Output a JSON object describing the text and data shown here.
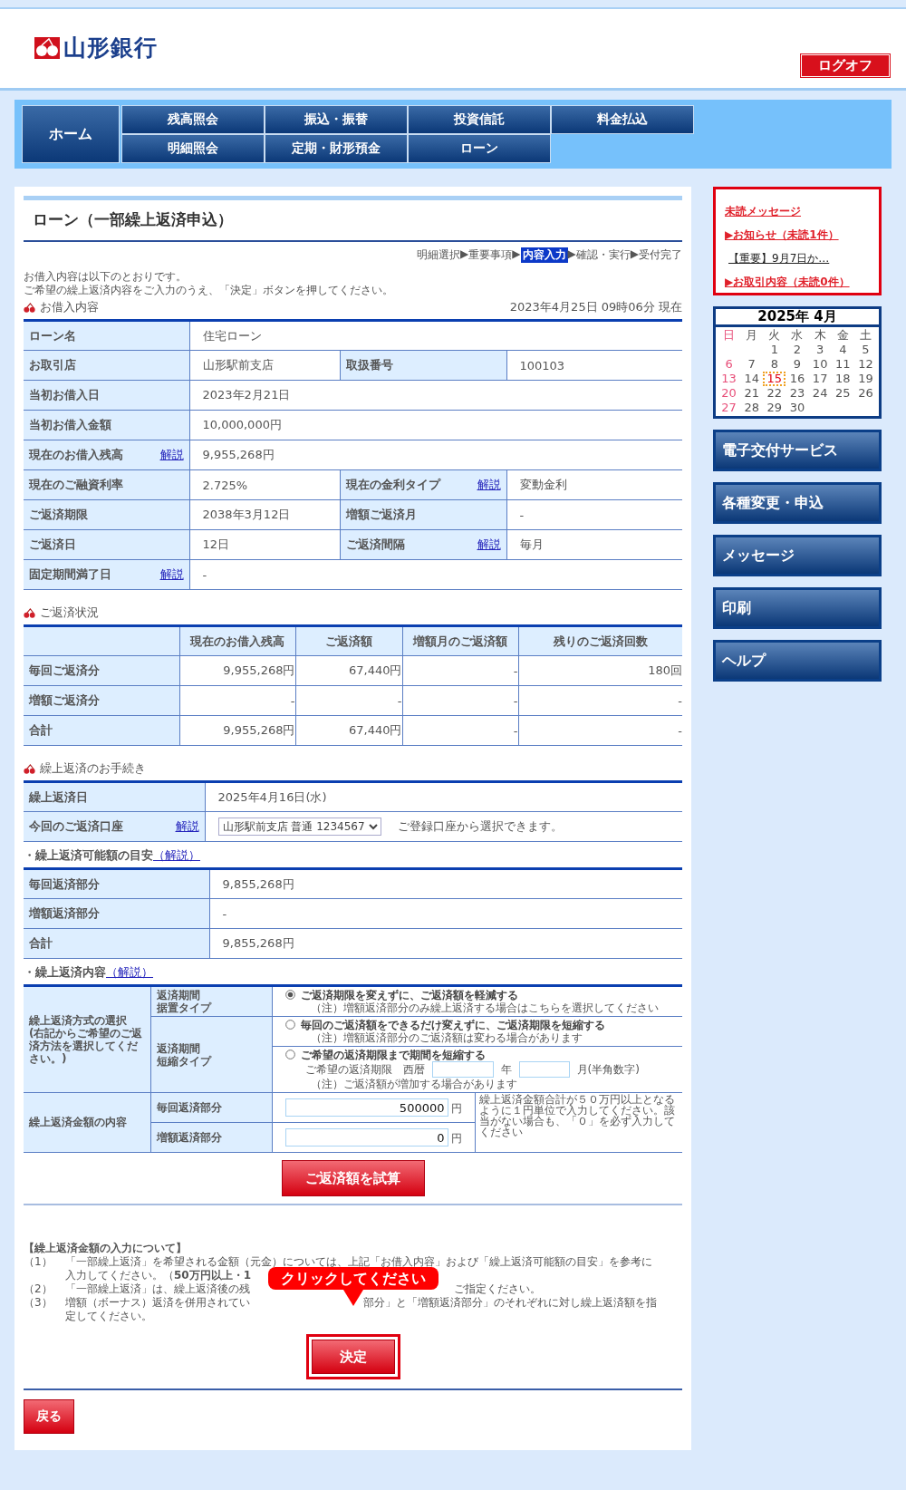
{
  "header": {
    "logo": "山形銀行",
    "logoff": "ログオフ"
  },
  "nav": {
    "home": "ホーム",
    "rows": [
      [
        "残高照会",
        "振込・振替",
        "投資信託",
        "料金払込"
      ],
      [
        "明細照会",
        "定期・財形預金",
        "ローン"
      ]
    ]
  },
  "page_title": "ローン（一部繰上返済申込）",
  "steps": [
    {
      "label": "明細選択",
      "selected": false,
      "after": "▶"
    },
    {
      "label": "重要事項",
      "selected": false,
      "after": "▶"
    },
    {
      "label": "内容入力",
      "selected": true,
      "after": "▶"
    },
    {
      "label": "確認・実行",
      "selected": false,
      "after": "▶"
    },
    {
      "label": "受付完了",
      "selected": false
    }
  ],
  "intro": [
    "お借入内容は以下のとおりです。",
    "ご希望の繰上返済内容をご入力のうえ、「決定」ボタンを押してください。"
  ],
  "loan": {
    "title": "お借入内容",
    "timestamp": "2023年4月25日 09時06分 現在",
    "rows": [
      [
        {
          "label": "ローン名",
          "value": "住宅ローン"
        }
      ],
      [
        {
          "label": "お取引店",
          "value": "山形駅前支店"
        },
        {
          "label": "取扱番号",
          "value": "100103"
        }
      ],
      [
        {
          "label": "当初お借入日",
          "value": "2023年2月21日"
        }
      ],
      [
        {
          "label": "当初お借入金額",
          "value": "10,000,000円"
        }
      ],
      [
        {
          "label": "現在のお借入残高",
          "help": "解説",
          "value": "9,955,268円"
        }
      ],
      [
        {
          "label": "現在のご融資利率",
          "value": "2.725%"
        },
        {
          "label": "現在の金利タイプ",
          "help": "解説",
          "value": "変動金利"
        }
      ],
      [
        {
          "label": "ご返済期限",
          "value": "2038年3月12日"
        },
        {
          "label": "増額ご返済月",
          "value": "-"
        }
      ],
      [
        {
          "label": "ご返済日",
          "value": "12日"
        },
        {
          "label": "ご返済間隔",
          "help": "解説",
          "value": "毎月"
        }
      ],
      [
        {
          "label": "固定期間満了日",
          "help": "解説",
          "value": "-"
        }
      ]
    ]
  },
  "status": {
    "title": "ご返済状況",
    "columns": [
      "現在のお借入残高",
      "ご返済額",
      "増額月のご返済額",
      "残りのご返済回数"
    ],
    "rows": [
      {
        "label": "毎回ご返済分",
        "cells": [
          "9,955,268円",
          "67,440円",
          "-",
          "180回"
        ]
      },
      {
        "label": "増額ご返済分",
        "cells": [
          "-",
          "-",
          "-",
          "-"
        ]
      },
      {
        "label": "合計",
        "cells": [
          "9,955,268円",
          "67,440円",
          "-",
          "-"
        ]
      }
    ]
  },
  "procedure": {
    "title": "繰上返済のお手続き",
    "date_label": "繰上返済日",
    "date": "2025年4月16日(水)",
    "account_label": "今回のご返済口座",
    "help": "解説",
    "account": "山形駅前支店 普通 1234567",
    "account_note": "ご登録口座から選択できます。"
  },
  "estimate": {
    "title": "・繰上返済可能額の目安",
    "help": "（解説）",
    "rows": [
      {
        "label": "毎回返済部分",
        "value": "9,855,268円"
      },
      {
        "label": "増額返済部分",
        "value": "-"
      },
      {
        "label": "合計",
        "value": "9,855,268円"
      }
    ]
  },
  "content": {
    "title": "・繰上返済内容",
    "help": "（解説）",
    "method_title": "繰上返済方式の選択",
    "method_note": "(右記からご希望のご返済方法を選択してください。)",
    "groups": [
      {
        "type_label": [
          "返済期間",
          "据置タイプ"
        ],
        "options": [
          {
            "kind": "plain",
            "label": "ご返済期限を変えずに、ご返済額を軽減する",
            "note": "（注）増額返済部分のみ繰上返済する場合はこちらを選択してください",
            "selected": true
          }
        ]
      },
      {
        "type_label": [
          "返済期間",
          "短縮タイプ"
        ],
        "options": [
          {
            "kind": "plain",
            "label": "毎回のご返済額をできるだけ変えずに、ご返済期限を短縮する",
            "note": "（注）増額返済部分のご返済額は変わる場合があります",
            "selected": false
          },
          {
            "kind": "date",
            "label": "ご希望の返済期限まで期間を短縮する",
            "date_label": "ご希望の返済期限　西暦",
            "year_unit": "年",
            "month_unit": "月(半角数字)",
            "note": "（注）ご返済額が増加する場合があります",
            "selected": false
          }
        ]
      }
    ],
    "amount_label": "繰上返済金額の内容",
    "amounts": [
      {
        "label": "毎回返済部分",
        "value": "500000",
        "unit": "円"
      },
      {
        "label": "増額返済部分",
        "value": "0",
        "unit": "円"
      }
    ],
    "amount_note": "繰上返済金額合計が５０万円以上となるように１円単位で入力してください。該当がない場合も、「０」を必ず入力してください"
  },
  "simulate_button": "ご返済額を試算",
  "notes": {
    "title": "【繰上返済金額の入力について】",
    "items": [
      {
        "number": "（1）",
        "lines": [
          [
            "「一部繰上返済」を希望される金額（元金）については、上記「お借入内容」および「繰上返済可能額の目安」を参考に"
          ],
          [
            "入力してください。（**50万円以上・1**"
          ]
        ]
      },
      {
        "number": "（2）",
        "lines": [
          [
            "「一部繰上返済」は、繰上返済後の残",
            "ご指定ください。"
          ]
        ]
      },
      {
        "number": "（3）",
        "lines": [
          [
            "増額（ボーナス）返済を併用されてい",
            "部分」と「増額返済部分」のそれぞれに対し繰上返済額を指"
          ],
          [
            "定してください。"
          ]
        ]
      }
    ]
  },
  "tooltip": "クリックしてください",
  "decide_button": "決定",
  "back_button": "戻る",
  "sidebar": {
    "messages": {
      "title": "未読メッセージ",
      "links": [
        {
          "kind": "alert",
          "text": "▶お知らせ（未読1件）"
        },
        {
          "kind": "item",
          "text": "【重要】9月7日か…"
        },
        {
          "kind": "alert",
          "text": "▶お取引内容（未読0件）"
        }
      ]
    },
    "calendar": {
      "title": "2025年 4月",
      "weekdays": [
        "日",
        "月",
        "火",
        "水",
        "木",
        "金",
        "土"
      ],
      "weeks": [
        [
          {
            "day": "1",
            "today": false
          },
          {
            "day": "2",
            "today": false
          },
          {
            "day": "3",
            "today": false
          },
          {
            "day": "4",
            "today": false
          },
          {
            "day": "5",
            "today": false
          }
        ],
        [
          {
            "day": "6",
            "today": false
          },
          {
            "day": "7",
            "today": false
          },
          {
            "day": "8",
            "today": false
          },
          {
            "day": "9",
            "today": false
          },
          {
            "day": "10",
            "today": false
          },
          {
            "day": "11",
            "today": false
          },
          {
            "day": "12",
            "today": false
          }
        ],
        [
          {
            "day": "13",
            "today": false
          },
          {
            "day": "14",
            "today": false
          },
          {
            "day": "15",
            "today": true
          },
          {
            "day": "16",
            "today": false
          },
          {
            "day": "17",
            "today": false
          },
          {
            "day": "18",
            "today": false
          },
          {
            "day": "19",
            "today": false
          }
        ],
        [
          {
            "day": "20",
            "today": false
          },
          {
            "day": "21",
            "today": false
          },
          {
            "day": "22",
            "today": false
          },
          {
            "day": "23",
            "today": false
          },
          {
            "day": "24",
            "today": false
          },
          {
            "day": "25",
            "today": false
          },
          {
            "day": "26",
            "today": false
          }
        ],
        [
          {
            "day": "27",
            "today": false
          },
          {
            "day": "28",
            "today": false
          },
          {
            "day": "29",
            "today": false
          },
          {
            "day": "30",
            "today": false
          }
        ]
      ]
    },
    "menu": [
      "電子交付サービス",
      "各種変更・申込",
      "メッセージ",
      "印刷",
      "ヘルプ"
    ]
  }
}
